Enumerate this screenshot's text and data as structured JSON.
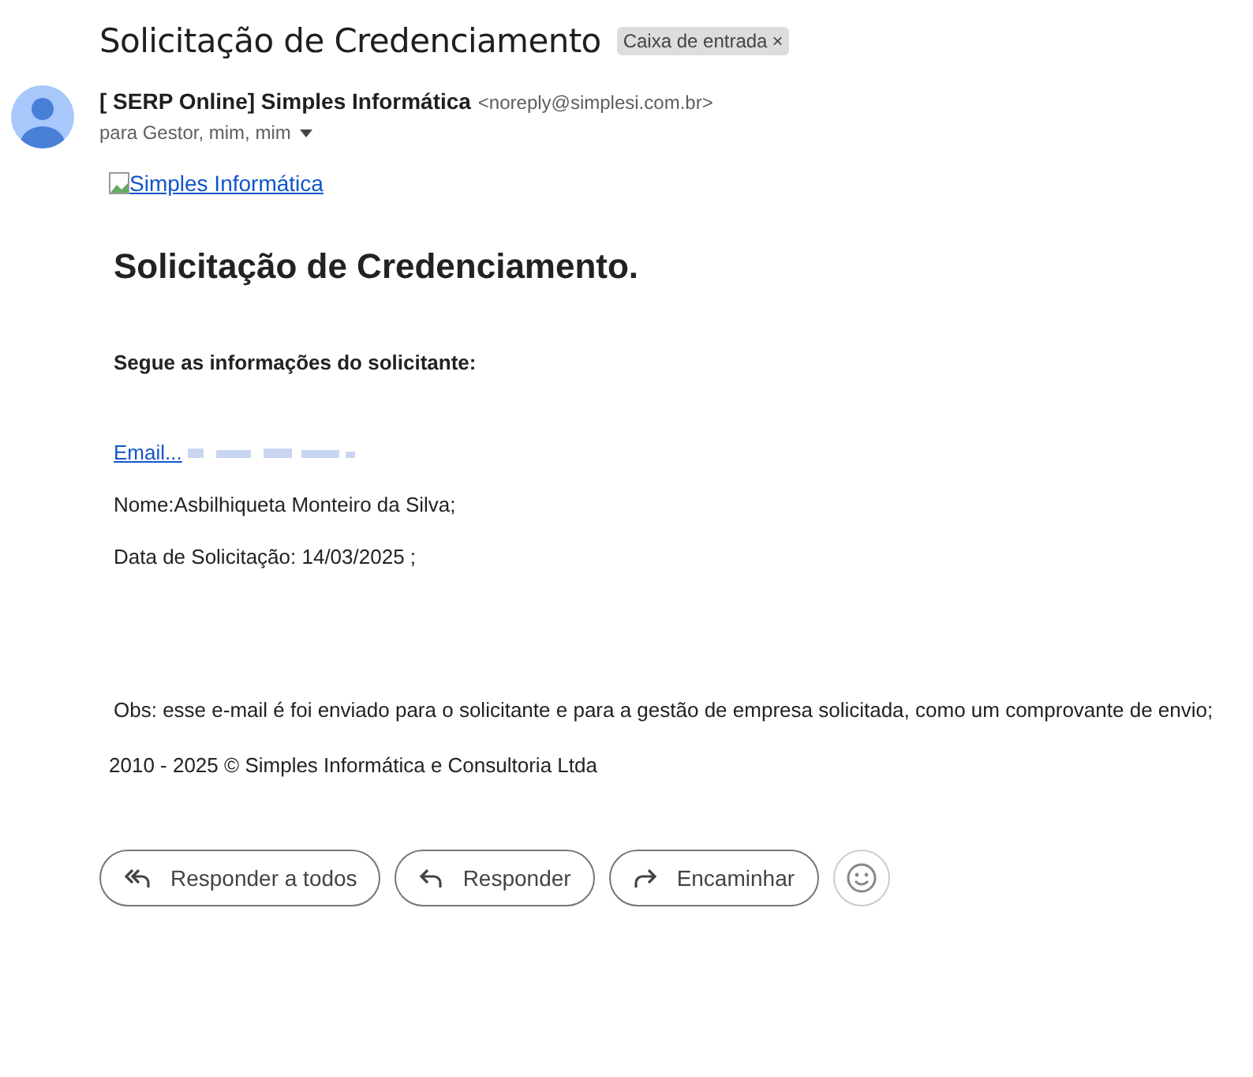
{
  "subject": "Solicitação de Credenciamento",
  "label": {
    "text": "Caixa de entrada",
    "close": "×"
  },
  "sender": {
    "name": "[ SERP Online] Simples Informática",
    "email": "<noreply@simplesi.com.br>",
    "recipients": "para Gestor, mim, mim"
  },
  "body": {
    "logo_alt": "Simples Informática",
    "heading": "Solicitação de Credenciamento.",
    "intro": "Segue as informações do solicitante:",
    "email_link": "Email...",
    "name_line": "Nome:Asbilhiqueta Monteiro da Silva;",
    "date_line": "Data de Solicitação: 14/03/2025 ;",
    "note": "Obs: esse e-mail é foi enviado para o solicitante e para a gestão de empresa solicitada, como um comprovante de envio;",
    "footer": "2010 - 2025 © Simples Informática e Consultoria Ltda"
  },
  "actions": [
    {
      "kind": "reply-all",
      "label": "Responder a todos"
    },
    {
      "kind": "reply",
      "label": "Responder"
    },
    {
      "kind": "forward",
      "label": "Encaminhar"
    }
  ]
}
